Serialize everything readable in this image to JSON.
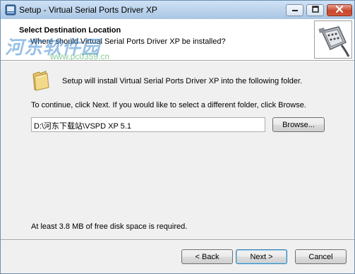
{
  "window": {
    "title": "Setup - Virtual Serial Ports Driver XP"
  },
  "header": {
    "title": "Select Destination Location",
    "subtitle": "Where should Virtual Serial Ports Driver XP be installed?"
  },
  "watermark": {
    "text": "河东软件园",
    "url": "www.pc0359.cn"
  },
  "body": {
    "intro": "Setup will install Virtual Serial Ports Driver XP into the following folder.",
    "instruction": "To continue, click Next. If you would like to select a different folder, click Browse.",
    "path_value": "D:\\河东下载站\\VSPD XP 5.1",
    "browse_label": "Browse...",
    "space_note": "At least 3.8 MB of free disk space is required."
  },
  "footer": {
    "back_label": "< Back",
    "next_label": "Next >",
    "cancel_label": "Cancel"
  },
  "icons": {
    "app": "setup-app-icon",
    "folder": "folder-icon",
    "header_image": "serial-connector-icon",
    "minimize": "minimize-icon",
    "maximize": "maximize-icon",
    "close": "close-icon"
  },
  "colors": {
    "titlebar": "#b9d1ea",
    "close_button": "#c9452b",
    "window_bg": "#f0f0f0",
    "header_bg": "#ffffff"
  }
}
